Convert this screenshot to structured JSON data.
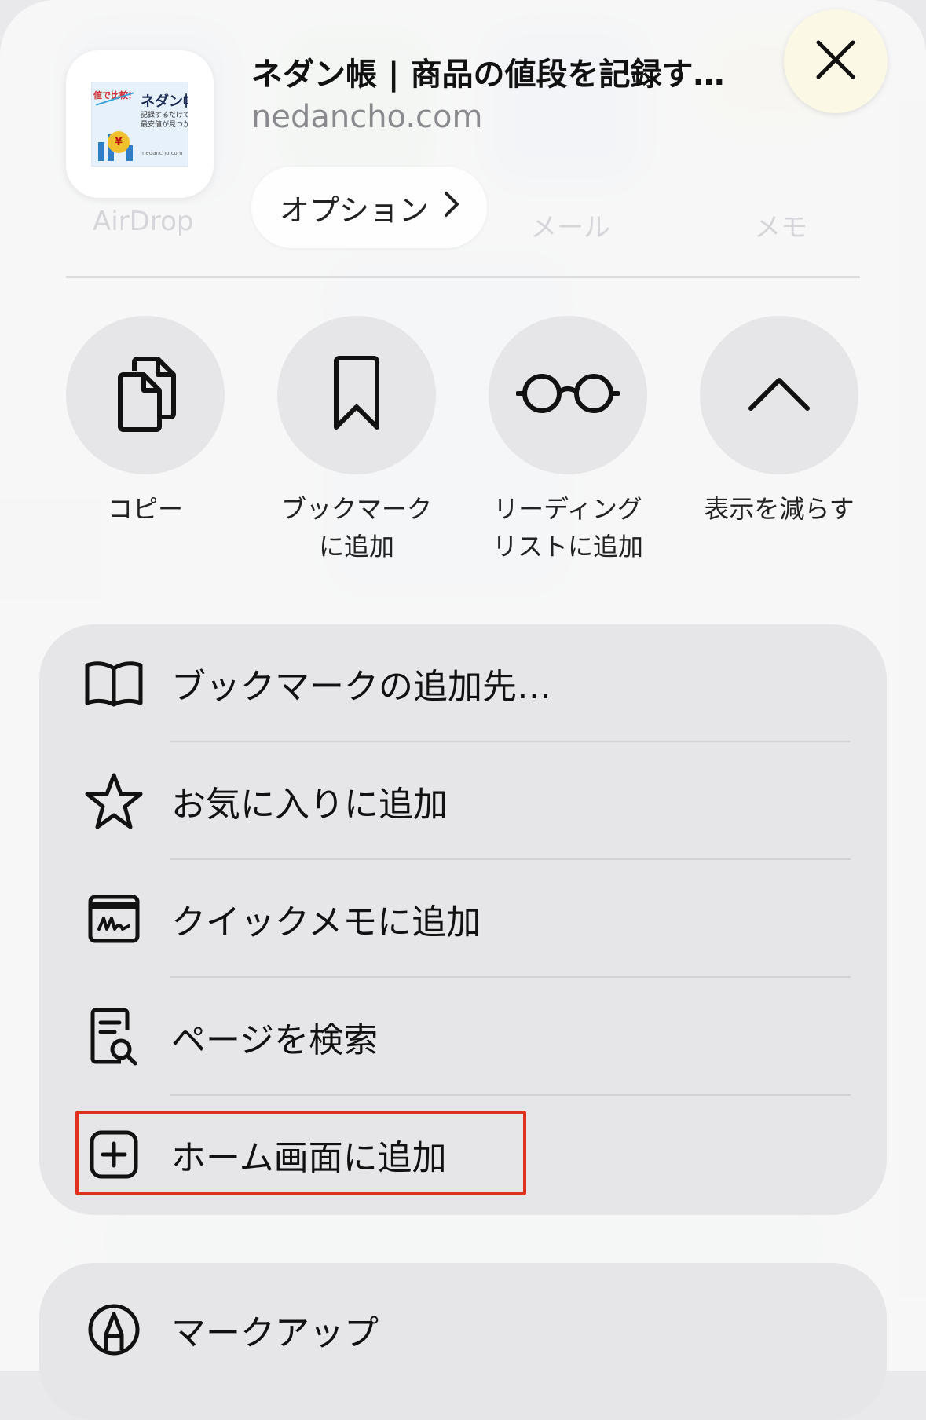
{
  "header": {
    "title": "ネダン帳 | 商品の値段を記録す…",
    "domain": "nedancho.com",
    "options_label": "オプション",
    "thumbnail": {
      "heading": "ネダン帳",
      "line1": "記録するだけで、",
      "line2": "最安値が見つかる",
      "tag": "値で比較!",
      "yen": "¥",
      "url": "nedancho.com"
    }
  },
  "background_labels": [
    "AirDrop",
    "メール",
    "メモ"
  ],
  "actions": [
    {
      "label": "コピー",
      "icon": "copy-icon"
    },
    {
      "label": "ブックマーク\nに追加",
      "icon": "bookmark-icon"
    },
    {
      "label": "リーディング\nリストに追加",
      "icon": "glasses-icon"
    },
    {
      "label": "表示を減らす",
      "icon": "chevron-up-icon"
    }
  ],
  "menu": [
    {
      "label": "ブックマークの追加先…",
      "icon": "book-icon"
    },
    {
      "label": "お気に入りに追加",
      "icon": "star-icon"
    },
    {
      "label": "クイックメモに追加",
      "icon": "quick-note-icon"
    },
    {
      "label": "ページを検索",
      "icon": "find-on-page-icon"
    },
    {
      "label": "ホーム画面に追加",
      "icon": "add-square-icon",
      "highlighted": true
    }
  ],
  "menu2": [
    {
      "label": "マークアップ",
      "icon": "markup-pen-icon"
    }
  ],
  "colors": {
    "highlight": "#e0301e",
    "close_button_bg": "#fbf8e6",
    "group_bg": "#e6e6e9"
  }
}
